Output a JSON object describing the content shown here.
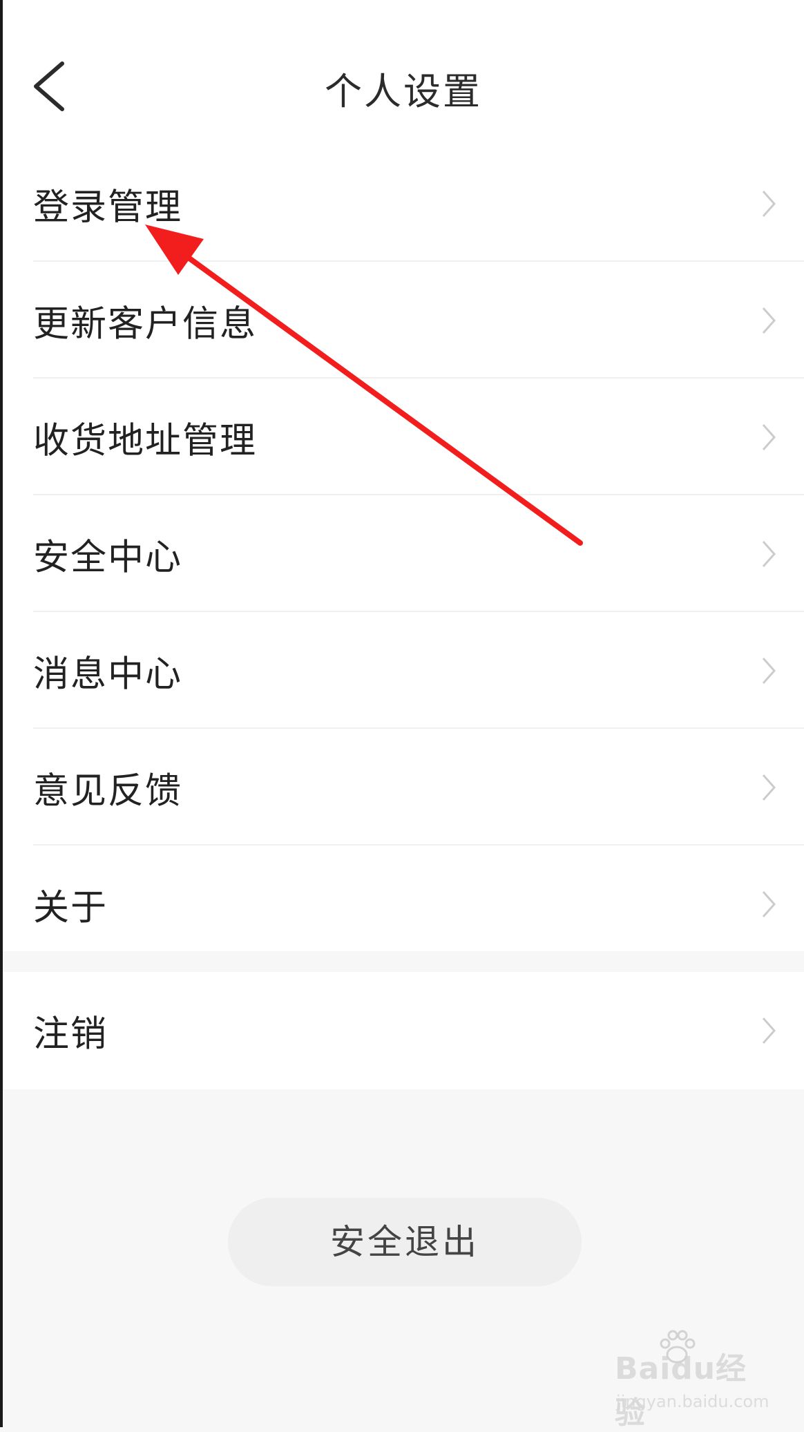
{
  "header": {
    "title": "个人设置",
    "back_icon": "chevron-left-icon"
  },
  "menu": {
    "items": [
      {
        "label": "登录管理"
      },
      {
        "label": "更新客户信息"
      },
      {
        "label": "收货地址管理"
      },
      {
        "label": "安全中心"
      },
      {
        "label": "消息中心"
      },
      {
        "label": "意见反馈"
      },
      {
        "label": "关于"
      }
    ],
    "extra": [
      {
        "label": "注销"
      }
    ]
  },
  "logout_label": "安全退出",
  "watermark": {
    "brand": "Baidu经验",
    "url": "jingyan.baidu.com"
  },
  "colors": {
    "annotation_arrow": "#f21d1d",
    "page_background": "#f7f7f7",
    "card_background": "#ffffff",
    "chevron": "#cccccc"
  }
}
